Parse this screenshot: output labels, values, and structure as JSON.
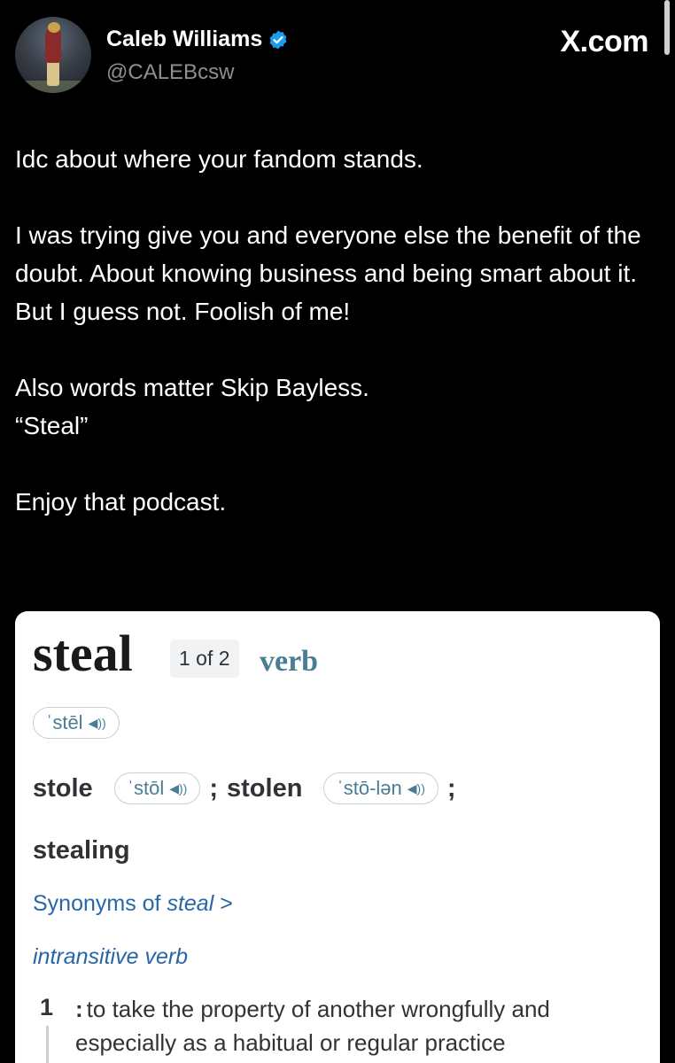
{
  "header": {
    "display_name": "Caleb Williams",
    "handle": "@CALEBcsw",
    "site_logo": "X.com",
    "verified_icon": "verified-badge-icon",
    "accent_color": "#1d9bf0"
  },
  "tweet": {
    "paragraphs": [
      "Idc about where your fandom stands.",
      "I was trying give you and everyone else the benefit of the doubt. About knowing business and being smart about it. But I guess not. Foolish of me!",
      "Also words matter Skip Bayless.\n“Steal”",
      "Enjoy that podcast."
    ]
  },
  "dictionary": {
    "headword": "steal",
    "entry_number": "1 of 2",
    "part_of_speech": "verb",
    "pronunciation": "ˈstēl",
    "forms": [
      {
        "word": "stole",
        "pronunciation": "ˈstōl"
      },
      {
        "word": "stolen",
        "pronunciation": "ˈstō-lən"
      }
    ],
    "separator": ";",
    "form_last": "stealing",
    "synonyms_prefix": "Synonyms of ",
    "synonyms_word": "steal",
    "synonyms_chevron": ">",
    "function_label": "intransitive verb",
    "sense_number": "1",
    "definition_colon": ":",
    "definition": "to take the property of another wrongfully and especially as a habitual or regular practice",
    "speaker_icon": "speaker-icon",
    "link_color": "#2866a8",
    "pos_color": "#4a7d95"
  }
}
